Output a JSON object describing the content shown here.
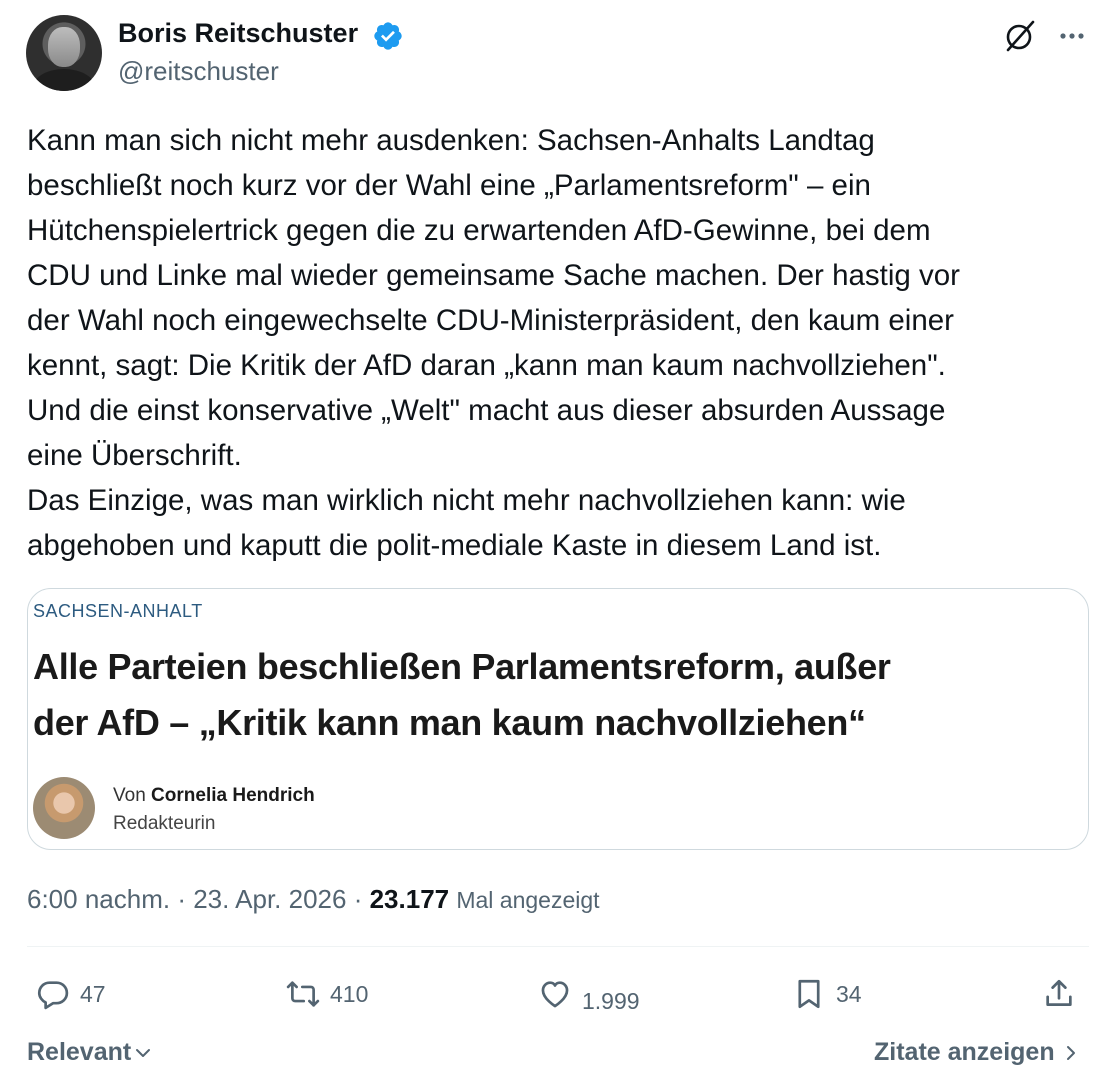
{
  "author": {
    "name": "Boris Reitschuster",
    "handle": "@reitschuster"
  },
  "header_icons": [
    "grok-icon",
    "more-icon"
  ],
  "tweet": {
    "lines": [
      "Kann man sich nicht mehr ausdenken: Sachsen-Anhalts Landtag",
      "beschließt noch kurz vor der Wahl eine „Parlamentsreform\" – ein",
      "Hütchenspielertrick gegen die zu erwartenden AfD-Gewinne, bei dem",
      "CDU und Linke mal wieder gemeinsame Sache machen. Der hastig vor",
      "der Wahl noch eingewechselte CDU-Ministerpräsident, den kaum einer",
      "kennt, sagt: Die Kritik der AfD daran „kann man kaum nachvollziehen\".",
      "Und die einst konservative „Welt\" macht aus dieser absurden Aussage",
      "eine Überschrift.",
      "Das Einzige, was man wirklich nicht mehr nachvollziehen kann: wie",
      "abgehoben und kaputt die polit-mediale Kaste in diesem Land ist."
    ]
  },
  "card": {
    "kicker": "SACHSEN-ANHALT",
    "headline_lines": [
      "Alle Parteien beschließen Parlamentsreform, außer",
      "der AfD – „Kritik kann man kaum nachvollziehen“"
    ],
    "author_prefix": "Von",
    "author_name": "Cornelia Hendrich",
    "author_role": "Redakteurin"
  },
  "meta": {
    "time": "6:00 nachm.",
    "date": "23. Apr. 2026",
    "views": "23.177",
    "views_label": "Mal angezeigt"
  },
  "actions": {
    "replies": "47",
    "reposts": "410",
    "likes": "1.999",
    "bookmarks": "34"
  },
  "footer": {
    "sort_label": "Relevant",
    "quotes_label": "Zitate anzeigen"
  },
  "colors": {
    "verified": "#1d9bf0",
    "secondary_text": "#536471",
    "kicker": "#2d5b80"
  }
}
